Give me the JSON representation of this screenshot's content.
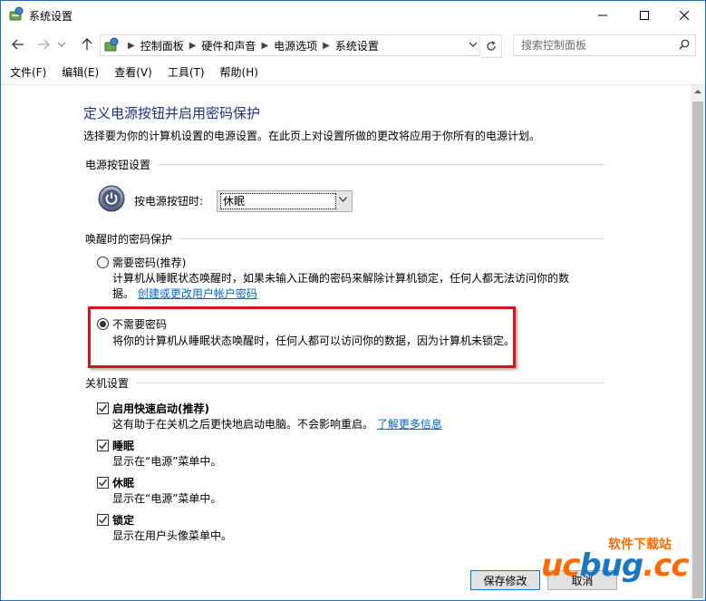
{
  "window": {
    "title": "系统设置"
  },
  "address": {
    "breadcrumbs": [
      "控制面板",
      "硬件和声音",
      "电源选项",
      "系统设置"
    ]
  },
  "search": {
    "placeholder": "搜索控制面板"
  },
  "menu": [
    "文件(F)",
    "编辑(E)",
    "查看(V)",
    "工具(T)",
    "帮助(H)"
  ],
  "page": {
    "title": "定义电源按钮并启用密码保护",
    "description": "选择要为你的计算机设置的电源设置。在此页上对设置所做的更改将应用于你所有的电源计划。"
  },
  "power_button": {
    "section": "电源按钮设置",
    "label": "按电源按钮时:",
    "value": "休眠"
  },
  "password": {
    "section": "唤醒时的密码保护",
    "options": [
      {
        "label": "需要密码(推荐)",
        "desc_line1": "计算机从睡眠状态唤醒时，如果未输入正确的密码来解除计算机锁定，任何人都无法访问你的数",
        "desc_line2": "据。",
        "link": "创建或更改用户帐户密码",
        "selected": false
      },
      {
        "label": "不需要密码",
        "desc": "将你的计算机从睡眠状态唤醒时，任何人都可以访问你的数据，因为计算机未锁定。",
        "selected": true
      }
    ]
  },
  "shutdown": {
    "section": "关机设置",
    "items": [
      {
        "label": "启用快速启动(推荐)",
        "desc": "这有助于在关机之后更快地启动电脑。不会影响重启。",
        "link": "了解更多信息",
        "checked": true
      },
      {
        "label": "睡眠",
        "desc": "显示在“电源”菜单中。",
        "checked": true
      },
      {
        "label": "休眠",
        "desc": "显示在“电源”菜单中。",
        "checked": true
      },
      {
        "label": "锁定",
        "desc": "显示在用户头像菜单中。",
        "checked": true
      }
    ]
  },
  "buttons": {
    "save": "保存修改",
    "cancel": "取消"
  },
  "watermark": {
    "text": "软件下载站",
    "logo_o": "uc",
    "logo_b": "bug",
    "logo_tld": ".cc"
  },
  "colors": {
    "title_blue": "#1e3287",
    "link_blue": "#0066cc",
    "highlight_red": "#d7141b"
  }
}
